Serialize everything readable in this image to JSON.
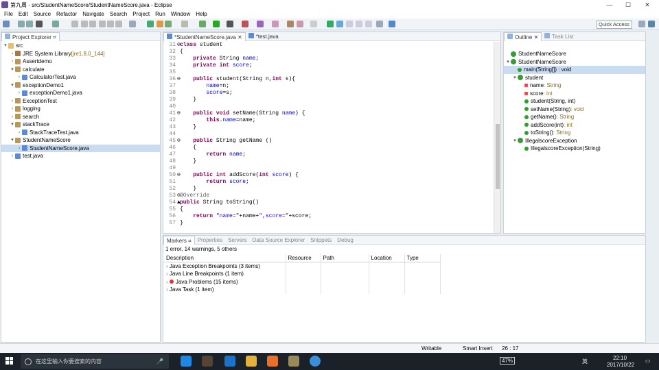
{
  "window": {
    "title": "第九周 - src/StudentNameScore/StudentNameScore.java - Eclipse",
    "min": "—",
    "max": "☐",
    "close": "✕"
  },
  "menu": [
    "File",
    "Edit",
    "Source",
    "Refactor",
    "Navigate",
    "Search",
    "Project",
    "Run",
    "Window",
    "Help"
  ],
  "quick_access": "Quick Access",
  "explorer": {
    "tab": "Project Explorer",
    "items": [
      {
        "t": "src",
        "lvl": 0,
        "kind": "folder",
        "tw": "▾"
      },
      {
        "t": "JRE System Library",
        "dec": " [jre1.8.0_144]",
        "lvl": 1,
        "kind": "lib",
        "tw": "›"
      },
      {
        "t": "Assertdemo",
        "lvl": 1,
        "kind": "pkg",
        "tw": "›"
      },
      {
        "t": "calculate",
        "lvl": 1,
        "kind": "pkg",
        "tw": "▾"
      },
      {
        "t": "CalculatorTest.java",
        "lvl": 2,
        "kind": "java",
        "tw": "›"
      },
      {
        "t": "exceptionDemo1",
        "lvl": 1,
        "kind": "pkg",
        "tw": "▾"
      },
      {
        "t": "exceptionDemo1.java",
        "lvl": 2,
        "kind": "java",
        "tw": "›"
      },
      {
        "t": "ExceptionTest",
        "lvl": 1,
        "kind": "pkg",
        "tw": "›"
      },
      {
        "t": "logging",
        "lvl": 1,
        "kind": "pkg",
        "tw": "›"
      },
      {
        "t": "search",
        "lvl": 1,
        "kind": "pkg",
        "tw": "›"
      },
      {
        "t": "stackTrace",
        "lvl": 1,
        "kind": "pkg",
        "tw": "▾"
      },
      {
        "t": "StackTraceTest.java",
        "lvl": 2,
        "kind": "java",
        "tw": "›"
      },
      {
        "t": "StudentNameScore",
        "lvl": 1,
        "kind": "pkg",
        "tw": "▾"
      },
      {
        "t": "StudentNameScore.java",
        "lvl": 2,
        "kind": "java",
        "tw": "›",
        "sel": true
      },
      {
        "t": "test.java",
        "lvl": 1,
        "kind": "java",
        "tw": "›"
      }
    ]
  },
  "editor": {
    "tabs": [
      "*StudentNameScore.java",
      "*test.java"
    ],
    "lines": [
      {
        "n": "31",
        "m": "⊖",
        "c": [
          [
            "kw",
            "class "
          ],
          [
            "",
            "student"
          ]
        ]
      },
      {
        "n": "32",
        "c": [
          [
            "",
            "{"
          ]
        ]
      },
      {
        "n": "33",
        "c": [
          [
            "",
            "    "
          ],
          [
            "kw",
            "private "
          ],
          [
            "",
            "String "
          ],
          [
            "fd",
            "name"
          ],
          [
            "",
            ";"
          ]
        ]
      },
      {
        "n": "34",
        "c": [
          [
            "",
            "    "
          ],
          [
            "kw",
            "private int "
          ],
          [
            "fd",
            "score"
          ],
          [
            "",
            ";"
          ]
        ]
      },
      {
        "n": "35",
        "c": []
      },
      {
        "n": "36",
        "m": "⊖",
        "c": [
          [
            "",
            "    "
          ],
          [
            "kw",
            "public "
          ],
          [
            "",
            "student(String n,"
          ],
          [
            "kw",
            "int "
          ],
          [
            "",
            "s){"
          ]
        ]
      },
      {
        "n": "37",
        "c": [
          [
            "",
            "        "
          ],
          [
            "fd",
            "name"
          ],
          [
            "",
            "=n;"
          ]
        ]
      },
      {
        "n": "38",
        "c": [
          [
            "",
            "        "
          ],
          [
            "fd",
            "score"
          ],
          [
            "",
            "=s;"
          ]
        ]
      },
      {
        "n": "39",
        "c": [
          [
            "",
            "    }"
          ]
        ]
      },
      {
        "n": "40",
        "c": []
      },
      {
        "n": "41",
        "m": "⊖",
        "c": [
          [
            "",
            "    "
          ],
          [
            "kw",
            "public void "
          ],
          [
            "",
            "setName(String "
          ],
          [
            "fd",
            "name"
          ],
          [
            "",
            ") {"
          ]
        ]
      },
      {
        "n": "42",
        "c": [
          [
            "",
            "        "
          ],
          [
            "kw",
            "this"
          ],
          [
            "",
            "."
          ],
          [
            "fd",
            "name"
          ],
          [
            "",
            "=name;"
          ]
        ]
      },
      {
        "n": "43",
        "c": [
          [
            "",
            "    }"
          ]
        ]
      },
      {
        "n": "44",
        "c": []
      },
      {
        "n": "45",
        "m": "⊖",
        "c": [
          [
            "",
            "    "
          ],
          [
            "kw",
            "public "
          ],
          [
            "",
            "String getName ()"
          ]
        ]
      },
      {
        "n": "46",
        "c": [
          [
            "",
            "    {"
          ]
        ]
      },
      {
        "n": "47",
        "c": [
          [
            "",
            "        "
          ],
          [
            "kw",
            "return "
          ],
          [
            "fd",
            "name"
          ],
          [
            "",
            ";"
          ]
        ]
      },
      {
        "n": "48",
        "c": [
          [
            "",
            "    }"
          ]
        ]
      },
      {
        "n": "49",
        "c": []
      },
      {
        "n": "50",
        "m": "⊖",
        "c": [
          [
            "",
            "    "
          ],
          [
            "kw",
            "public int "
          ],
          [
            "",
            "addScore("
          ],
          [
            "kw",
            "int "
          ],
          [
            "fd",
            "score"
          ],
          [
            "",
            ") {"
          ]
        ]
      },
      {
        "n": "51",
        "c": [
          [
            "",
            "        "
          ],
          [
            "kw",
            "return "
          ],
          [
            "fd",
            "score"
          ],
          [
            "",
            ";"
          ]
        ]
      },
      {
        "n": "52",
        "c": [
          [
            "",
            "    }"
          ]
        ]
      },
      {
        "n": "53",
        "m": "⊖",
        "c": [
          [
            "an",
            "@Override"
          ]
        ]
      },
      {
        "n": "54",
        "m": "▲",
        "c": [
          [
            "kw",
            "public "
          ],
          [
            "",
            "String toString()"
          ]
        ]
      },
      {
        "n": "55",
        "c": [
          [
            "",
            "{"
          ]
        ]
      },
      {
        "n": "56",
        "c": [
          [
            "",
            "    "
          ],
          [
            "kw",
            "return "
          ],
          [
            "st",
            "\"name=\""
          ],
          [
            "",
            "+name+"
          ],
          [
            "st",
            "\",score=\""
          ],
          [
            "",
            "+score;"
          ]
        ]
      },
      {
        "n": "57",
        "c": [
          [
            "",
            "}"
          ]
        ]
      }
    ]
  },
  "outline": {
    "tabs": [
      "Outline",
      "Task List"
    ],
    "items": [
      {
        "t": "StudentNameScore",
        "lvl": 0,
        "kind": "cls",
        "tw": ""
      },
      {
        "t": "StudentNameScore",
        "lvl": 0,
        "kind": "cls",
        "tw": "▾"
      },
      {
        "t": "main(String[]) : void",
        "lvl": 1,
        "kind": "meth",
        "tw": "",
        "sel": true
      },
      {
        "t": "student",
        "lvl": 0,
        "kind": "cls",
        "tw": "▾",
        "ind": 1
      },
      {
        "t": "name",
        "sub": " : String",
        "lvl": 2,
        "kind": "field",
        "tw": ""
      },
      {
        "t": "score",
        "sub": " : int",
        "lvl": 2,
        "kind": "field",
        "tw": ""
      },
      {
        "t": "student(String, int)",
        "lvl": 2,
        "kind": "meth",
        "tw": ""
      },
      {
        "t": "setName(String)",
        "sub": " : void",
        "lvl": 2,
        "kind": "meth",
        "tw": ""
      },
      {
        "t": "getName()",
        "sub": " : String",
        "lvl": 2,
        "kind": "meth",
        "tw": ""
      },
      {
        "t": "addScore(int)",
        "sub": " : int",
        "lvl": 2,
        "kind": "meth",
        "tw": ""
      },
      {
        "t": "toString()",
        "sub": " : String",
        "lvl": 2,
        "kind": "meth",
        "tw": ""
      },
      {
        "t": "IllegalscoreException",
        "lvl": 1,
        "kind": "cls",
        "tw": "▾"
      },
      {
        "t": "IllegalscoreException(String)",
        "lvl": 2,
        "kind": "meth",
        "tw": ""
      }
    ]
  },
  "markers": {
    "tabs": [
      "Markers",
      "Properties",
      "Servers",
      "Data Source Explorer",
      "Snippets",
      "Debug"
    ],
    "summary": "1 error, 14 warnings, 5 others",
    "columns": [
      "Description",
      "Resource",
      "Path",
      "Location",
      "Type"
    ],
    "rows": [
      {
        "d": "Java Exception Breakpoints (3 items)",
        "err": false
      },
      {
        "d": "Java Line Breakpoints (1 item)",
        "err": false
      },
      {
        "d": "Java Problems (15 items)",
        "err": true
      },
      {
        "d": "Java Task (1 item)",
        "err": false
      }
    ]
  },
  "status": {
    "writable": "Writable",
    "insert": "Smart Insert",
    "pos": "26 : 17"
  },
  "taskbar": {
    "search": "在这里输入你要搜索的内容",
    "battery": "47%",
    "ime": "英",
    "time": "22:10",
    "date": "2017/10/22"
  }
}
